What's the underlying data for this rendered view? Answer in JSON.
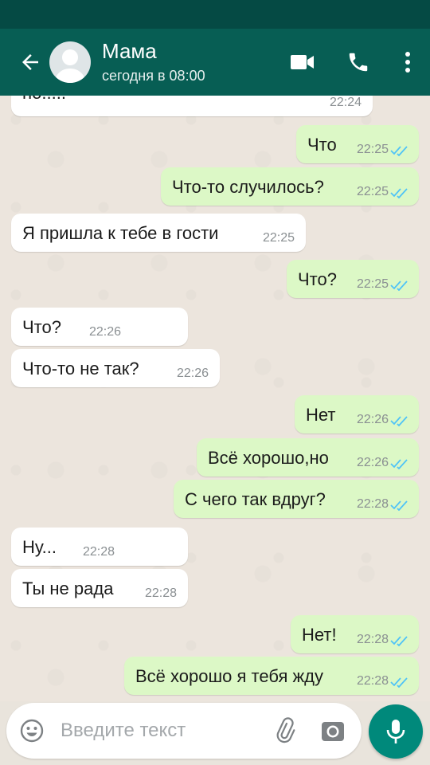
{
  "header": {
    "contact_name": "Мама",
    "last_seen": "сегодня в 08:00"
  },
  "colors": {
    "app_bar": "#075e54",
    "status_bar": "#054a44",
    "outgoing_bubble": "#dcf8c6",
    "incoming_bubble": "#ffffff",
    "read_ticks": "#4fc3f7",
    "mic_button": "#00897b"
  },
  "messages": [
    {
      "direction": "in",
      "text": "но.....",
      "time": "22:24"
    },
    {
      "direction": "out",
      "text": "Что",
      "time": "22:25",
      "status": "read"
    },
    {
      "direction": "out",
      "text": "Что-то случилось?",
      "time": "22:25",
      "status": "read"
    },
    {
      "direction": "in",
      "text": "Я пришла к тебе в гости",
      "time": "22:25"
    },
    {
      "direction": "out",
      "text": "Что?",
      "time": "22:25",
      "status": "read"
    },
    {
      "direction": "in",
      "text": "Что?",
      "time": "22:26"
    },
    {
      "direction": "in",
      "text": "Что-то не так?",
      "time": "22:26"
    },
    {
      "direction": "out",
      "text": "Нет",
      "time": "22:26",
      "status": "read"
    },
    {
      "direction": "out",
      "text": "Всё хорошо,но",
      "time": "22:26",
      "status": "read"
    },
    {
      "direction": "out",
      "text": "С чего так вдруг?",
      "time": "22:28",
      "status": "read"
    },
    {
      "direction": "in",
      "text": "Ну...",
      "time": "22:28"
    },
    {
      "direction": "in",
      "text": "Ты не рада",
      "time": "22:28"
    },
    {
      "direction": "out",
      "text": "Нет!",
      "time": "22:28",
      "status": "read"
    },
    {
      "direction": "out",
      "text": "Всё хорошо я тебя жду",
      "time": "22:28",
      "status": "read"
    }
  ],
  "composer": {
    "placeholder": "Введите текст"
  },
  "icons": {
    "back": "arrow-left-icon",
    "avatar": "avatar-icon",
    "video_call": "video-camera-icon",
    "voice_call": "phone-icon",
    "menu": "more-vertical-icon",
    "emoji": "emoji-icon",
    "attach": "paperclip-icon",
    "camera": "camera-icon",
    "mic": "microphone-icon",
    "read": "double-check-icon"
  }
}
